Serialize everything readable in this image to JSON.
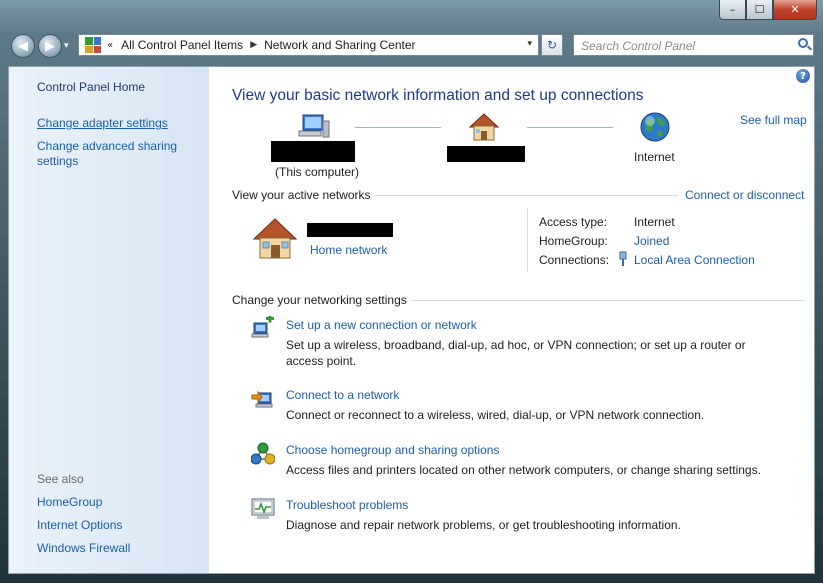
{
  "window": {
    "controls": {
      "minimize": "–",
      "maximize": "☐",
      "close": "✕"
    }
  },
  "navbar": {
    "back_glyph": "◀",
    "forward_glyph": "▶",
    "dropdown_glyph": "▾",
    "address": {
      "overflow": "«",
      "crumbs": [
        "All Control Panel Items",
        "Network and Sharing Center"
      ],
      "separator": "▶",
      "arrow": "▾"
    },
    "refresh_glyph": "↻",
    "search_placeholder": "Search Control Panel"
  },
  "sidebar": {
    "home": "Control Panel Home",
    "links": [
      "Change adapter settings",
      "Change advanced sharing settings"
    ],
    "see_also_title": "See also",
    "see_also": [
      "HomeGroup",
      "Internet Options",
      "Windows Firewall"
    ]
  },
  "main": {
    "help_glyph": "?",
    "title": "View your basic network information and set up connections",
    "see_full_map": "See full map",
    "network_map": {
      "this_computer": "(This computer)",
      "internet": "Internet"
    },
    "active_networks": {
      "heading": "View your active networks",
      "connect_link": "Connect or disconnect",
      "network_type": "Home network",
      "properties": [
        {
          "label": "Access type:",
          "value": "Internet",
          "is_link": false
        },
        {
          "label": "HomeGroup:",
          "value": "Joined",
          "is_link": true
        },
        {
          "label": "Connections:",
          "value": "Local Area Connection",
          "is_link": true
        }
      ]
    },
    "settings": {
      "heading": "Change your networking settings",
      "tasks": [
        {
          "title": "Set up a new connection or network",
          "desc": "Set up a wireless, broadband, dial-up, ad hoc, or VPN connection; or set up a router or access point.",
          "icon": "new-connection-icon"
        },
        {
          "title": "Connect to a network",
          "desc": "Connect or reconnect to a wireless, wired, dial-up, or VPN network connection.",
          "icon": "connect-network-icon"
        },
        {
          "title": "Choose homegroup and sharing options",
          "desc": "Access files and printers located on other network computers, or change sharing settings.",
          "icon": "homegroup-icon"
        },
        {
          "title": "Troubleshoot problems",
          "desc": "Diagnose and repair network problems, or get troubleshooting information.",
          "icon": "troubleshoot-icon"
        }
      ]
    }
  },
  "colors": {
    "link": "#1a5fae",
    "title": "#1e3b8a",
    "sidebar_bg": "#dfeaf6"
  }
}
